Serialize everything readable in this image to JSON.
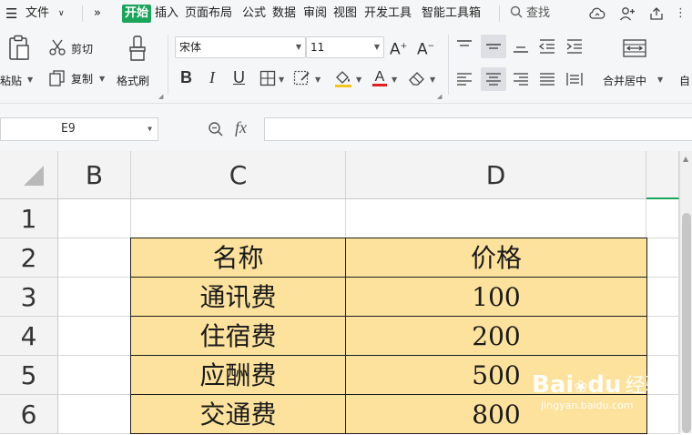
{
  "menubar": {
    "file_label": "文件",
    "tabs": [
      "开始",
      "插入",
      "页面布局",
      "公式",
      "数据",
      "审阅",
      "视图",
      "开发工具",
      "智能工具箱"
    ],
    "search_label": "查找"
  },
  "ribbon": {
    "paste_label": "粘贴",
    "cut_label": "剪切",
    "copy_label": "复制",
    "format_painter_label": "格式刷",
    "font_name": "宋体",
    "font_size": "11",
    "merge_label": "合并居中",
    "auto_wrap_label": "自"
  },
  "formula_bar": {
    "cell_ref": "E9",
    "fx_label": "fx",
    "formula": ""
  },
  "sheet": {
    "columns": [
      "B",
      "C",
      "D"
    ],
    "rows": [
      "1",
      "2",
      "3",
      "4",
      "5",
      "6"
    ],
    "header": {
      "name": "名称",
      "price": "价格"
    },
    "data": [
      {
        "name": "通讯费",
        "price": "100"
      },
      {
        "name": "住宿费",
        "price": "200"
      },
      {
        "name": "应酬费",
        "price": "500"
      },
      {
        "name": "交通费",
        "price": "800"
      }
    ],
    "fill_color": "#fce29d"
  },
  "watermark": {
    "brand_a": "Bai",
    "brand_b": "du",
    "brand_cn": "经验",
    "url": "jingyan.baidu.com"
  }
}
